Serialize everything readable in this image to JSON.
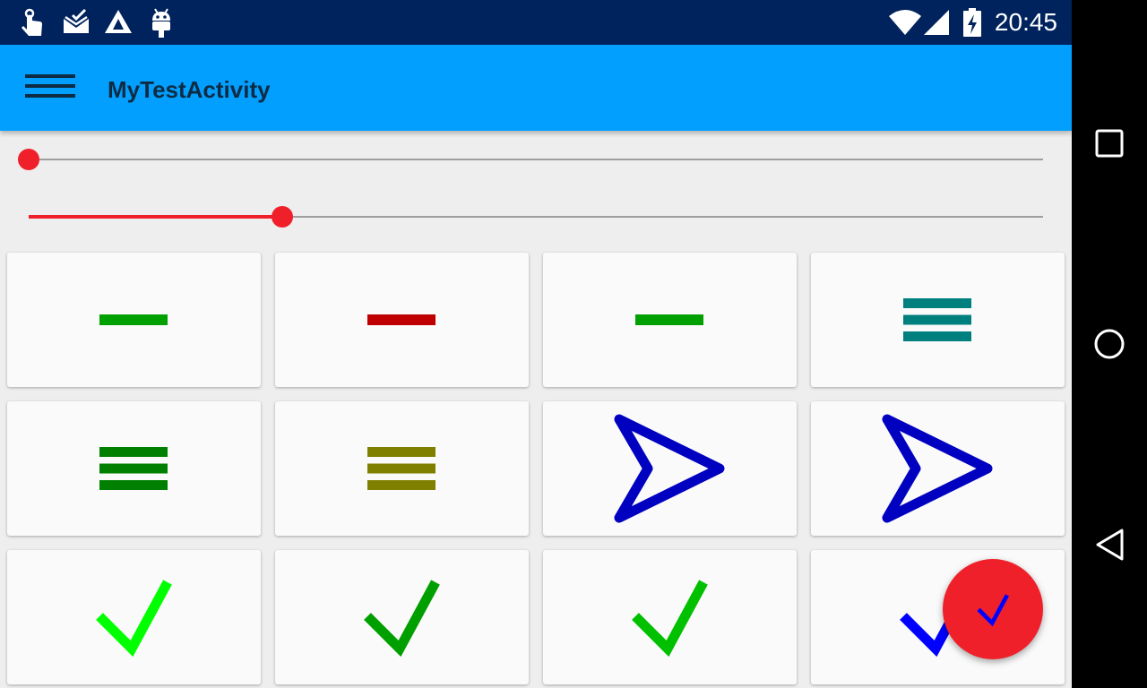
{
  "status_bar": {
    "time": "20:45",
    "left_icons": [
      "touch-icon",
      "mail-check-icon",
      "triangle-app-icon",
      "android-icon"
    ],
    "right_icons": [
      "wifi-icon",
      "signal-icon",
      "battery-charging-icon"
    ]
  },
  "app_bar": {
    "title": "MyTestActivity",
    "background": "#039ffe"
  },
  "sliders": [
    {
      "value": 0.0
    },
    {
      "value": 0.25
    }
  ],
  "accent_color": "#f0202a",
  "tiles": [
    {
      "icon": "minus-icon",
      "color": "#00a000"
    },
    {
      "icon": "minus-icon",
      "color": "#c00000"
    },
    {
      "icon": "minus-icon",
      "color": "#00a000"
    },
    {
      "icon": "menu-icon",
      "color": "#007f7f"
    },
    {
      "icon": "menu-icon",
      "color": "#007f00"
    },
    {
      "icon": "menu-icon",
      "color": "#808000"
    },
    {
      "icon": "send-arrow-icon",
      "color": "#0000c0"
    },
    {
      "icon": "send-arrow-icon",
      "color": "#0000c0"
    },
    {
      "icon": "checkmark-icon",
      "color": "#00ff00"
    },
    {
      "icon": "checkmark-icon",
      "color": "#009f00"
    },
    {
      "icon": "checkmark-icon",
      "color": "#00c000"
    },
    {
      "icon": "checkmark-icon",
      "color": "#0000ff"
    }
  ],
  "fab": {
    "icon": "checkmark-icon",
    "color": "#0000ff"
  },
  "nav_bar": {
    "buttons": [
      "recent-apps-icon",
      "home-icon",
      "back-icon"
    ]
  }
}
